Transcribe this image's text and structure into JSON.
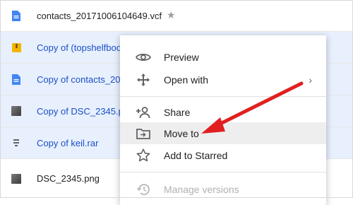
{
  "files": [
    {
      "name": "contacts_20171006104649.vcf",
      "icon": "doc-icon",
      "selected": false,
      "starred": true
    },
    {
      "name": "Copy of (topshelfboo",
      "icon": "archive-icon",
      "selected": true
    },
    {
      "name": "Copy of contacts_201",
      "icon": "doc-icon",
      "selected": true
    },
    {
      "name": "Copy of DSC_2345.pn",
      "icon": "image-icon",
      "selected": true
    },
    {
      "name": "Copy of keil.rar",
      "icon": "rar-icon",
      "selected": true
    },
    {
      "name": "DSC_2345.png",
      "icon": "image-icon",
      "selected": false
    }
  ],
  "menu": {
    "preview": "Preview",
    "open_with": "Open with",
    "share": "Share",
    "move_to": "Move to",
    "add_to_starred": "Add to Starred",
    "manage_versions": "Manage versions"
  },
  "colors": {
    "selected_row": "#e8f0fe",
    "selected_text": "#1a4fc8",
    "doc_icon": "#4285f4",
    "archive_icon": "#f4b400",
    "annotation_arrow": "#e02020"
  }
}
